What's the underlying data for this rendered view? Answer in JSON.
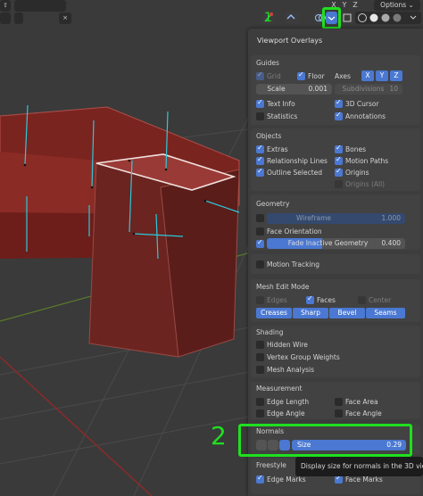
{
  "header": {
    "axis_letters": [
      "X",
      "Y",
      "Z"
    ],
    "options_label": "Options",
    "options_caret": "⌄"
  },
  "panel": {
    "title": "Viewport Overlays",
    "guides": {
      "heading": "Guides",
      "grid": "Grid",
      "floor": "Floor",
      "axes": "Axes",
      "axis_x": "X",
      "axis_y": "Y",
      "axis_z": "Z",
      "scale_label": "Scale",
      "scale_value": "0.001",
      "subdivisions_label": "Subdivisions",
      "subdivisions_value": "10",
      "text_info": "Text Info",
      "cursor_3d": "3D Cursor",
      "statistics": "Statistics",
      "annotations": "Annotations"
    },
    "objects": {
      "heading": "Objects",
      "extras": "Extras",
      "bones": "Bones",
      "relationship_lines": "Relationship Lines",
      "motion_paths": "Motion Paths",
      "outline_selected": "Outline Selected",
      "origins": "Origins",
      "origins_all": "Origins (All)"
    },
    "geometry": {
      "heading": "Geometry",
      "wireframe_label": "Wireframe",
      "wireframe_value": "1.000",
      "face_orientation": "Face Orientation",
      "fade_label": "Fade Inactive Geometry",
      "fade_value": "0.400"
    },
    "motion_tracking": "Motion Tracking",
    "mesh_edit": {
      "heading": "Mesh Edit Mode",
      "edges": "Edges",
      "faces": "Faces",
      "center": "Center",
      "creases": "Creases",
      "sharp": "Sharp",
      "bevel": "Bevel",
      "seams": "Seams"
    },
    "shading": {
      "heading": "Shading",
      "hidden_wire": "Hidden Wire",
      "vertex_group_weights": "Vertex Group Weights",
      "mesh_analysis": "Mesh Analysis"
    },
    "measurement": {
      "heading": "Measurement",
      "edge_length": "Edge Length",
      "face_area": "Face Area",
      "edge_angle": "Edge Angle",
      "face_angle": "Face Angle"
    },
    "normals": {
      "heading": "Normals",
      "size_label": "Size",
      "size_value": "0.29"
    },
    "freestyle": {
      "heading": "Freestyle",
      "edge_marks": "Edge Marks",
      "face_marks": "Face Marks"
    }
  },
  "tooltip": "Display size for normals in the 3D view.",
  "annotations": {
    "number_1": "1",
    "number_2": "2"
  },
  "colors": {
    "accent": "#4a78d2",
    "highlight": "#1fe01f",
    "mesh": "#8a2a26"
  }
}
